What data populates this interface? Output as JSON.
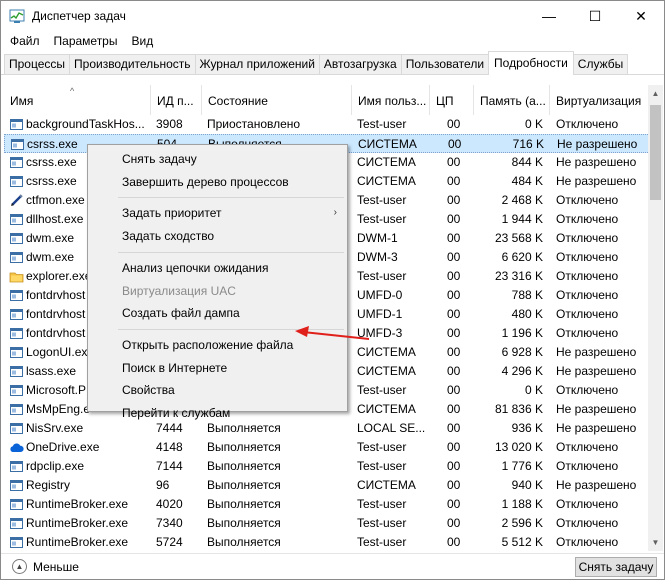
{
  "window": {
    "title": "Диспетчер задач",
    "controls": {
      "minimize": "—",
      "maximize": "☐",
      "close": "✕"
    }
  },
  "menu": [
    "Файл",
    "Параметры",
    "Вид"
  ],
  "tabs": [
    {
      "label": "Процессы",
      "active": false
    },
    {
      "label": "Производительность",
      "active": false
    },
    {
      "label": "Журнал приложений",
      "active": false
    },
    {
      "label": "Автозагрузка",
      "active": false
    },
    {
      "label": "Пользователи",
      "active": false
    },
    {
      "label": "Подробности",
      "active": true
    },
    {
      "label": "Службы",
      "active": false
    }
  ],
  "columns": {
    "name": "Имя",
    "pid": "ИД п...",
    "status": "Состояние",
    "user": "Имя польз...",
    "cpu": "ЦП",
    "memory": "Память (а...",
    "virtualization": "Виртуализация"
  },
  "rows": [
    {
      "name": "backgroundTaskHos...",
      "pid": "3908",
      "status": "Приостановлено",
      "user": "Test-user",
      "cpu": "00",
      "memory": "0 K",
      "virt": "Отключено",
      "icon": "process-icon"
    },
    {
      "name": "csrss.exe",
      "pid": "504",
      "status": "Выполняется",
      "user": "СИСТЕМА",
      "cpu": "00",
      "memory": "716 K",
      "virt": "Не разрешено",
      "icon": "process-icon",
      "selected": true
    },
    {
      "name": "csrss.exe",
      "pid": "",
      "status": "",
      "user": "СИСТЕМА",
      "cpu": "00",
      "memory": "844 K",
      "virt": "Не разрешено",
      "icon": "process-icon"
    },
    {
      "name": "csrss.exe",
      "pid": "",
      "status": "",
      "user": "СИСТЕМА",
      "cpu": "00",
      "memory": "484 K",
      "virt": "Не разрешено",
      "icon": "process-icon"
    },
    {
      "name": "ctfmon.exe",
      "pid": "",
      "status": "",
      "user": "Test-user",
      "cpu": "00",
      "memory": "2 468 K",
      "virt": "Отключено",
      "icon": "pen-icon"
    },
    {
      "name": "dllhost.exe",
      "pid": "",
      "status": "",
      "user": "Test-user",
      "cpu": "00",
      "memory": "1 944 K",
      "virt": "Отключено",
      "icon": "process-icon"
    },
    {
      "name": "dwm.exe",
      "pid": "",
      "status": "",
      "user": "DWM-1",
      "cpu": "00",
      "memory": "23 568 K",
      "virt": "Отключено",
      "icon": "process-icon"
    },
    {
      "name": "dwm.exe",
      "pid": "",
      "status": "",
      "user": "DWM-3",
      "cpu": "00",
      "memory": "6 620 K",
      "virt": "Отключено",
      "icon": "process-icon"
    },
    {
      "name": "explorer.exe",
      "pid": "",
      "status": "",
      "user": "Test-user",
      "cpu": "00",
      "memory": "23 316 K",
      "virt": "Отключено",
      "icon": "folder-icon"
    },
    {
      "name": "fontdrvhost",
      "pid": "",
      "status": "",
      "user": "UMFD-0",
      "cpu": "00",
      "memory": "788 K",
      "virt": "Отключено",
      "icon": "process-icon"
    },
    {
      "name": "fontdrvhost",
      "pid": "",
      "status": "",
      "user": "UMFD-1",
      "cpu": "00",
      "memory": "480 K",
      "virt": "Отключено",
      "icon": "process-icon"
    },
    {
      "name": "fontdrvhost",
      "pid": "",
      "status": "",
      "user": "UMFD-3",
      "cpu": "00",
      "memory": "1 196 K",
      "virt": "Отключено",
      "icon": "process-icon"
    },
    {
      "name": "LogonUI.exe",
      "pid": "",
      "status": "",
      "user": "СИСТЕМА",
      "cpu": "00",
      "memory": "6 928 K",
      "virt": "Не разрешено",
      "icon": "process-icon"
    },
    {
      "name": "lsass.exe",
      "pid": "",
      "status": "",
      "user": "СИСТЕМА",
      "cpu": "00",
      "memory": "4 296 K",
      "virt": "Не разрешено",
      "icon": "process-icon"
    },
    {
      "name": "Microsoft.P",
      "pid": "",
      "status": "",
      "user": "Test-user",
      "cpu": "00",
      "memory": "0 K",
      "virt": "Отключено",
      "icon": "process-icon"
    },
    {
      "name": "MsMpEng.e",
      "pid": "",
      "status": "",
      "user": "СИСТЕМА",
      "cpu": "00",
      "memory": "81 836 K",
      "virt": "Не разрешено",
      "icon": "process-icon"
    },
    {
      "name": "NisSrv.exe",
      "pid": "7444",
      "status": "Выполняется",
      "user": "LOCAL SE...",
      "cpu": "00",
      "memory": "936 K",
      "virt": "Не разрешено",
      "icon": "process-icon"
    },
    {
      "name": "OneDrive.exe",
      "pid": "4148",
      "status": "Выполняется",
      "user": "Test-user",
      "cpu": "00",
      "memory": "13 020 K",
      "virt": "Отключено",
      "icon": "cloud-icon"
    },
    {
      "name": "rdpclip.exe",
      "pid": "7144",
      "status": "Выполняется",
      "user": "Test-user",
      "cpu": "00",
      "memory": "1 776 K",
      "virt": "Отключено",
      "icon": "process-icon"
    },
    {
      "name": "Registry",
      "pid": "96",
      "status": "Выполняется",
      "user": "СИСТЕМА",
      "cpu": "00",
      "memory": "940 K",
      "virt": "Не разрешено",
      "icon": "process-icon"
    },
    {
      "name": "RuntimeBroker.exe",
      "pid": "4020",
      "status": "Выполняется",
      "user": "Test-user",
      "cpu": "00",
      "memory": "1 188 K",
      "virt": "Отключено",
      "icon": "process-icon"
    },
    {
      "name": "RuntimeBroker.exe",
      "pid": "7340",
      "status": "Выполняется",
      "user": "Test-user",
      "cpu": "00",
      "memory": "2 596 K",
      "virt": "Отключено",
      "icon": "process-icon"
    },
    {
      "name": "RuntimeBroker.exe",
      "pid": "5724",
      "status": "Выполняется",
      "user": "Test-user",
      "cpu": "00",
      "memory": "5 512 K",
      "virt": "Отключено",
      "icon": "process-icon"
    }
  ],
  "context_menu": {
    "items": [
      {
        "label": "Снять задачу"
      },
      {
        "label": "Завершить дерево процессов"
      },
      {
        "sep": true
      },
      {
        "label": "Задать приоритет",
        "submenu": true
      },
      {
        "label": "Задать сходство"
      },
      {
        "sep": true
      },
      {
        "label": "Анализ цепочки ожидания"
      },
      {
        "label": "Виртуализация UAC",
        "disabled": true
      },
      {
        "label": "Создать файл дампа"
      },
      {
        "sep": true
      },
      {
        "label": "Открыть расположение файла"
      },
      {
        "label": "Поиск в Интернете"
      },
      {
        "label": "Свойства"
      },
      {
        "label": "Перейти к службам"
      }
    ],
    "submenu_glyph": "›"
  },
  "footer": {
    "less_label": "Меньше",
    "end_task_label": "Снять задачу"
  },
  "colors": {
    "selection": "#cce8ff",
    "annotation_arrow": "#e0201b"
  }
}
